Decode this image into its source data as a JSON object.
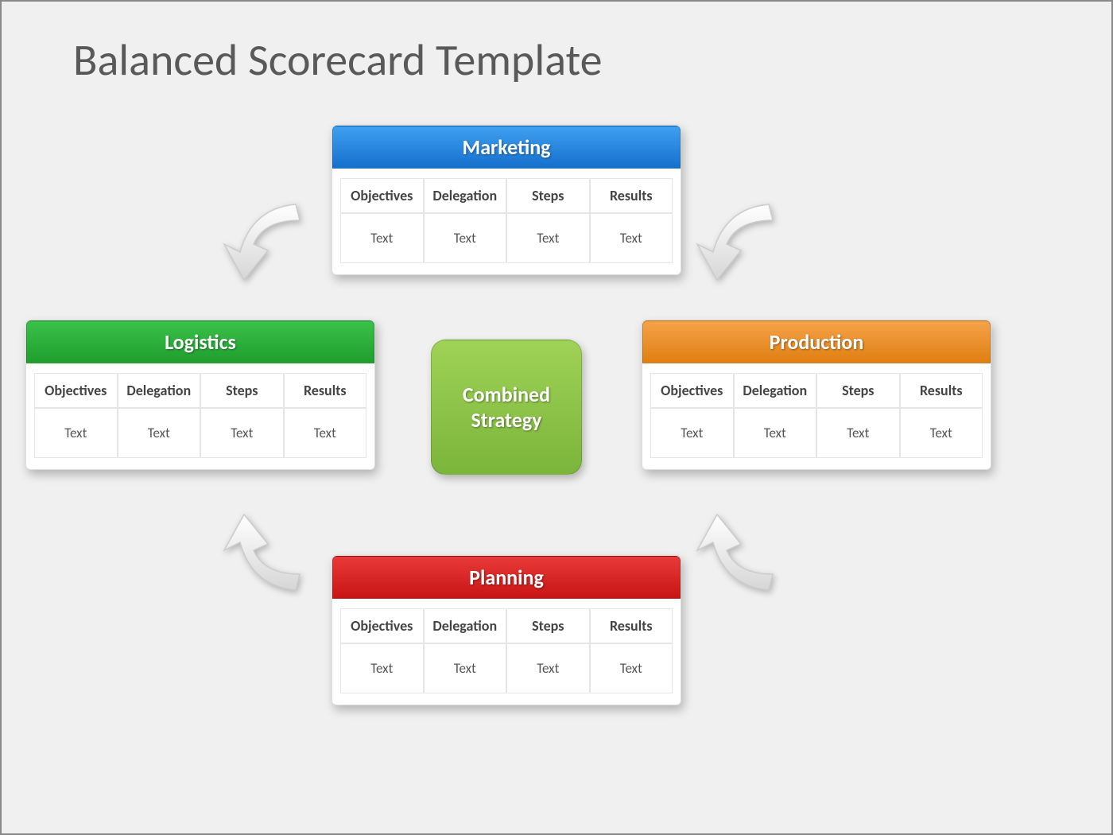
{
  "title": "Balanced Scorecard Template",
  "center": "Combined\nStrategy",
  "headers": [
    "Objectives",
    "Delegation",
    "Steps",
    "Results"
  ],
  "cards": {
    "top": {
      "title": "Marketing",
      "values": [
        "Text",
        "Text",
        "Text",
        "Text"
      ]
    },
    "left": {
      "title": "Logistics",
      "values": [
        "Text",
        "Text",
        "Text",
        "Text"
      ]
    },
    "right": {
      "title": "Production",
      "values": [
        "Text",
        "Text",
        "Text",
        "Text"
      ]
    },
    "bottom": {
      "title": "Planning",
      "values": [
        "Text",
        "Text",
        "Text",
        "Text"
      ]
    }
  }
}
